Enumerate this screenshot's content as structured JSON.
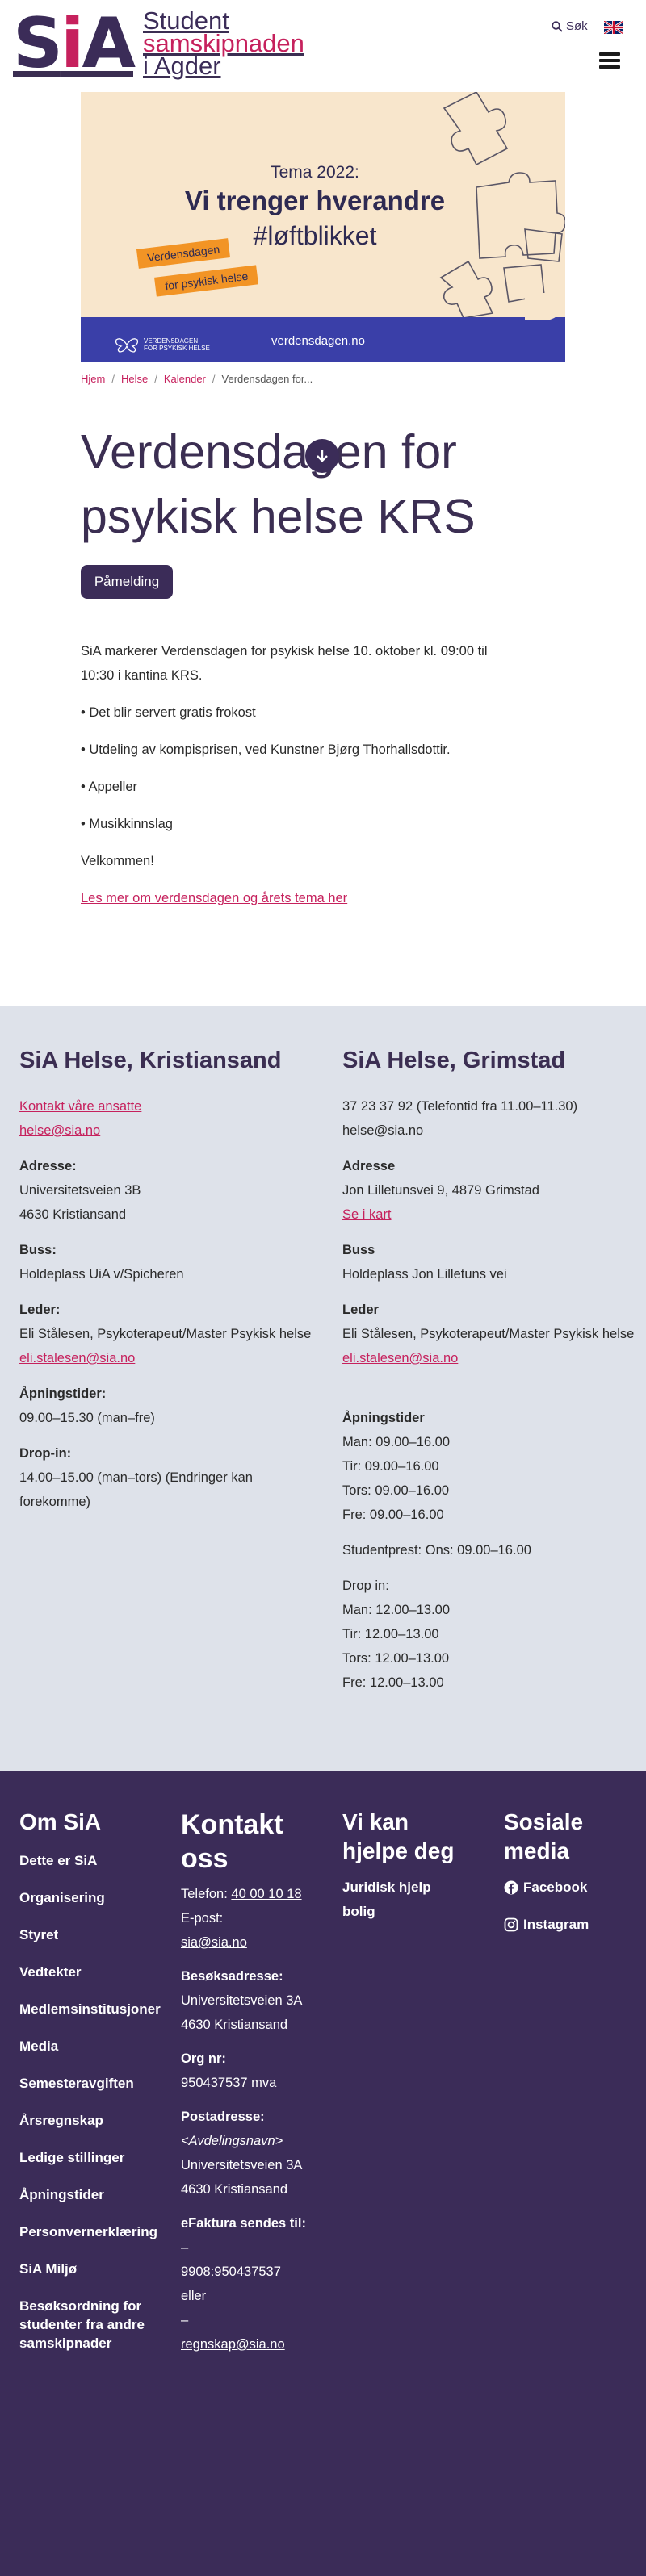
{
  "header": {
    "logo": "SiA",
    "logo_line1": "Student",
    "logo_line2": "samskipnaden",
    "logo_line3": "i Agder",
    "search_label": "Søk",
    "language_flag": "uk-flag-icon",
    "menu_icon": "hamburger-icon"
  },
  "banner": {
    "theme": "Tema 2022:",
    "title": "Vi trenger hverandre",
    "hashtag": "#løftblikket",
    "sticker1": "Verdensdagen",
    "sticker2": "for psykisk helse",
    "logo_line1": "VERDENSDAGEN",
    "logo_line2": "FOR PSYKISK HELSE",
    "url": "verdensdagen.no"
  },
  "breadcrumb": {
    "items": [
      "Hjem",
      "Helse",
      "Kalender"
    ],
    "current": "Verdensdagen for...",
    "separator": "/"
  },
  "event": {
    "title": "Verdensdagen for psykisk helse KRS",
    "signup_label": "Påmelding",
    "intro": "SiA markerer Verdensdagen for psykisk helse 10. oktober kl. 09:00 til 10:30 i kantina KRS.",
    "bullets": [
      "• Det blir servert gratis frokost",
      "• Utdeling av kompisprisen, ved Kunstner Bjørg Thorhallsdottir.",
      "• Appeller",
      "• Musikkinnslag"
    ],
    "welcome": "Velkommen!",
    "more_link": "Les mer om verdensdagen og årets tema her"
  },
  "contact_krs": {
    "heading": "SiA Helse, Kristiansand",
    "contact_link": "Kontakt våre ansatte",
    "email": "helse@sia.no",
    "address_label": "Adresse:",
    "address1": "Universitetsveien 3B",
    "address2": "4630 Kristiansand",
    "bus_label": "Buss:",
    "bus": "Holdeplass UiA v/Spicheren",
    "leader_label": "Leder:",
    "leader": "Eli Stålesen, Psykoterapeut/Master Psykisk helse",
    "leader_email": "eli.stalesen@sia.no",
    "hours_label": "Åpningstider:",
    "hours": "09.00–15.30 (man–fre)",
    "dropin_label": "Drop-in:",
    "dropin": "14.00–15.00 (man–tors) (Endringer kan forekomme)"
  },
  "contact_grm": {
    "heading": "SiA Helse, Grimstad",
    "phone": "37 23 37 92 (Telefontid fra 11.00–11.30)",
    "email": "helse@sia.no",
    "address_label": "Adresse",
    "address": "Jon Lilletunsvei 9, 4879 Grimstad",
    "map_link": "Se i kart",
    "bus_label": "Buss",
    "bus": "Holdeplass Jon Lilletuns vei",
    "leader_label": "Leder",
    "leader": "Eli Stålesen, Psykoterapeut/Master Psykisk helse",
    "leader_email": "eli.stalesen@sia.no",
    "hours_label": "Åpningstider",
    "hours": [
      "Man: 09.00–16.00",
      "Tir: 09.00–16.00",
      "Tors: 09.00–16.00",
      "Fre: 09.00–16.00"
    ],
    "student_priest": "Studentprest: Ons: 09.00–16.00",
    "dropin_label": "Drop in:",
    "dropin": [
      "Man: 12.00–13.00",
      "Tir: 12.00–13.00",
      "Tors: 12.00–13.00",
      "Fre: 12.00–13.00"
    ]
  },
  "footer": {
    "about_heading": "Om SiA",
    "about_links": [
      "Dette er SiA",
      "Organisering",
      "Styret",
      "Vedtekter",
      "Medlemsinstitusjoner",
      "Media",
      "Semesteravgiften",
      "Årsregnskap",
      "Ledige stillinger",
      "Åpningstider",
      "Personvernerklæring",
      "SiA Miljø",
      "Besøksordning for studenter fra andre samskipnader"
    ],
    "contact_heading": "Kontakt oss",
    "phone_label": "Telefon:",
    "phone": "40 00 10 18",
    "email_label": "E-post:",
    "email": "sia@sia.no",
    "visit_label": "Besøksadresse:",
    "visit_street": "Universitetsveien 3A",
    "visit_city": "4630 Kristiansand",
    "org_label": "Org nr:",
    "org": "950437537 mva",
    "post_label": "Postadresse:",
    "post_dept": "<Avdelingsnavn>",
    "post_street": "Universitetsveien 3A",
    "post_city": "4630 Kristiansand",
    "efaktura_label": "eFaktura sendes til:",
    "efaktura_dash1": "–",
    "efaktura_id": "9908:950437537",
    "efaktura_or": "eller",
    "efaktura_dash2": "–",
    "efaktura_email": "regnskap@sia.no",
    "help_heading": "Vi kan hjelpe deg",
    "help_links": [
      "Juridisk hjelp",
      "bolig"
    ],
    "social_heading": "Sosiale media",
    "social_links": [
      "Facebook",
      "Instagram"
    ]
  },
  "colors": {
    "brand_purple": "#3b2c58",
    "accent_pink": "#c6215d",
    "banner_beige": "#f8e6cc",
    "banner_blue": "#3a3fa8",
    "contact_bg": "#dee2ea"
  }
}
